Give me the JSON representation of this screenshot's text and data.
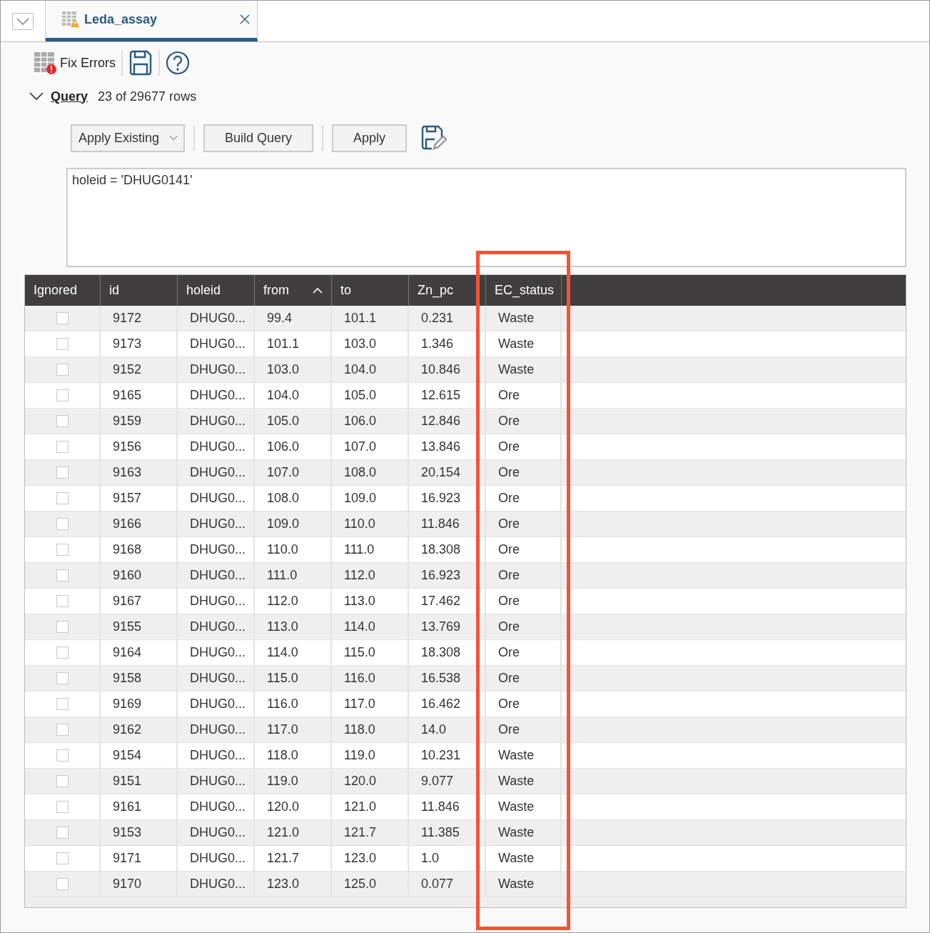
{
  "tab": {
    "title": "Leda_assay",
    "selected": true
  },
  "toolbar": {
    "fix_errors": "Fix Errors"
  },
  "query": {
    "label": "Query",
    "expanded": true,
    "row_count": "23 of 29677 rows",
    "buttons": [
      {
        "kind": "dropdown",
        "label": "Apply Existing"
      },
      {
        "kind": "button",
        "label": "Build Query"
      },
      {
        "kind": "button",
        "label": "Apply"
      }
    ],
    "expression": "holeid = 'DHUG0141'"
  },
  "table": {
    "checkbox_column": {
      "label": "Ignored"
    },
    "columns": [
      {
        "label": "id",
        "sorted": false,
        "highlighted": false
      },
      {
        "label": "holeid",
        "sorted": false,
        "highlighted": false
      },
      {
        "label": "from",
        "sorted": true,
        "highlighted": false
      },
      {
        "label": "to",
        "sorted": false,
        "highlighted": false
      },
      {
        "label": "Zn_pc",
        "sorted": false,
        "highlighted": false
      },
      {
        "label": "EC_status",
        "sorted": false,
        "highlighted": true
      }
    ],
    "rows": [
      {
        "ignored": false,
        "cells": [
          "9172",
          "DHUG0...",
          "99.4",
          "101.1",
          "0.231",
          "Waste"
        ]
      },
      {
        "ignored": false,
        "cells": [
          "9173",
          "DHUG0...",
          "101.1",
          "103.0",
          "1.346",
          "Waste"
        ]
      },
      {
        "ignored": false,
        "cells": [
          "9152",
          "DHUG0...",
          "103.0",
          "104.0",
          "10.846",
          "Waste"
        ]
      },
      {
        "ignored": false,
        "cells": [
          "9165",
          "DHUG0...",
          "104.0",
          "105.0",
          "12.615",
          "Ore"
        ]
      },
      {
        "ignored": false,
        "cells": [
          "9159",
          "DHUG0...",
          "105.0",
          "106.0",
          "12.846",
          "Ore"
        ]
      },
      {
        "ignored": false,
        "cells": [
          "9156",
          "DHUG0...",
          "106.0",
          "107.0",
          "13.846",
          "Ore"
        ]
      },
      {
        "ignored": false,
        "cells": [
          "9163",
          "DHUG0...",
          "107.0",
          "108.0",
          "20.154",
          "Ore"
        ]
      },
      {
        "ignored": false,
        "cells": [
          "9157",
          "DHUG0...",
          "108.0",
          "109.0",
          "16.923",
          "Ore"
        ]
      },
      {
        "ignored": false,
        "cells": [
          "9166",
          "DHUG0...",
          "109.0",
          "110.0",
          "11.846",
          "Ore"
        ]
      },
      {
        "ignored": false,
        "cells": [
          "9168",
          "DHUG0...",
          "110.0",
          "111.0",
          "18.308",
          "Ore"
        ]
      },
      {
        "ignored": false,
        "cells": [
          "9160",
          "DHUG0...",
          "111.0",
          "112.0",
          "16.923",
          "Ore"
        ]
      },
      {
        "ignored": false,
        "cells": [
          "9167",
          "DHUG0...",
          "112.0",
          "113.0",
          "17.462",
          "Ore"
        ]
      },
      {
        "ignored": false,
        "cells": [
          "9155",
          "DHUG0...",
          "113.0",
          "114.0",
          "13.769",
          "Ore"
        ]
      },
      {
        "ignored": false,
        "cells": [
          "9164",
          "DHUG0...",
          "114.0",
          "115.0",
          "18.308",
          "Ore"
        ]
      },
      {
        "ignored": false,
        "cells": [
          "9158",
          "DHUG0...",
          "115.0",
          "116.0",
          "16.538",
          "Ore"
        ]
      },
      {
        "ignored": false,
        "cells": [
          "9169",
          "DHUG0...",
          "116.0",
          "117.0",
          "16.462",
          "Ore"
        ]
      },
      {
        "ignored": false,
        "cells": [
          "9162",
          "DHUG0...",
          "117.0",
          "118.0",
          "14.0",
          "Ore"
        ]
      },
      {
        "ignored": false,
        "cells": [
          "9154",
          "DHUG0...",
          "118.0",
          "119.0",
          "10.231",
          "Waste"
        ]
      },
      {
        "ignored": false,
        "cells": [
          "9151",
          "DHUG0...",
          "119.0",
          "120.0",
          "9.077",
          "Waste"
        ]
      },
      {
        "ignored": false,
        "cells": [
          "9161",
          "DHUG0...",
          "120.0",
          "121.0",
          "11.846",
          "Waste"
        ]
      },
      {
        "ignored": false,
        "cells": [
          "9153",
          "DHUG0...",
          "121.0",
          "121.7",
          "11.385",
          "Waste"
        ]
      },
      {
        "ignored": false,
        "cells": [
          "9171",
          "DHUG0...",
          "121.7",
          "123.0",
          "1.0",
          "Waste"
        ]
      },
      {
        "ignored": false,
        "cells": [
          "9170",
          "DHUG0...",
          "123.0",
          "125.0",
          "0.077",
          "Waste"
        ]
      }
    ]
  }
}
